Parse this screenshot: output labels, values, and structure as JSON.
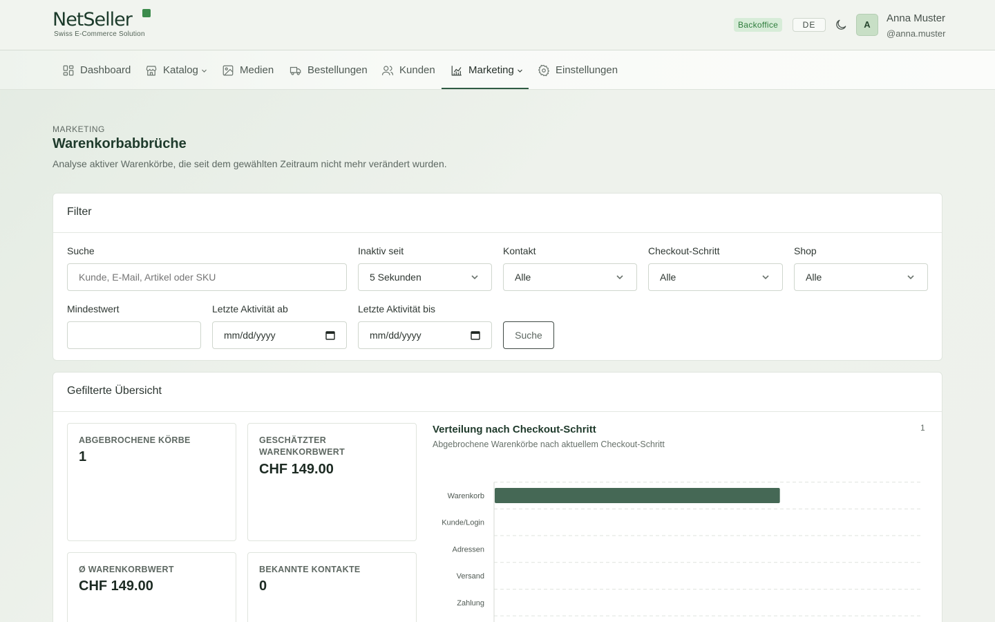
{
  "app": {
    "logo_text": "NetSeller",
    "logo_subtitle": "Swiss E-Commerce Solution",
    "backoffice_badge": "Backoffice",
    "language": "DE",
    "theme_icon": "moon-icon",
    "user": {
      "initial": "A",
      "name": "Anna Muster",
      "handle": "@anna.muster"
    }
  },
  "nav": {
    "items": [
      {
        "label": "Dashboard",
        "icon": "dashboard-icon"
      },
      {
        "label": "Katalog",
        "icon": "store-icon",
        "has_dropdown": true
      },
      {
        "label": "Medien",
        "icon": "image-icon"
      },
      {
        "label": "Bestellungen",
        "icon": "truck-icon"
      },
      {
        "label": "Kunden",
        "icon": "users-icon"
      },
      {
        "label": "Marketing",
        "icon": "chart-icon",
        "has_dropdown": true,
        "active": true
      },
      {
        "label": "Einstellungen",
        "icon": "gear-icon"
      }
    ]
  },
  "page": {
    "breadcrumb": "MARKETING",
    "title": "Warenkorbabbrüche",
    "description": "Analyse aktiver Warenkörbe, die seit dem gewählten Zeitraum nicht mehr verändert wurden."
  },
  "filter": {
    "title": "Filter",
    "search": {
      "label": "Suche",
      "placeholder": "Kunde, E-Mail, Artikel oder SKU",
      "value": ""
    },
    "inactive_since": {
      "label": "Inaktiv seit",
      "value": "5 Sekunden"
    },
    "contact": {
      "label": "Kontakt",
      "value": "Alle"
    },
    "checkout_step": {
      "label": "Checkout-Schritt",
      "value": "Alle"
    },
    "shop": {
      "label": "Shop",
      "value": "Alle"
    },
    "min_value": {
      "label": "Mindestwert",
      "value": ""
    },
    "last_activity_from": {
      "label": "Letzte Aktivität ab",
      "value": "mm/dd/yyyy"
    },
    "last_activity_to": {
      "label": "Letzte Aktivität bis",
      "value": "mm/dd/yyyy"
    },
    "search_button": "Suche"
  },
  "overview": {
    "title": "Gefilterte Übersicht",
    "stats": [
      {
        "label": "ABGEBROCHENE KÖRBE",
        "value": "1"
      },
      {
        "label": "GESCHÄTZTER WARENKORBWERT",
        "value": "CHF 149.00"
      },
      {
        "label": "Ø WARENKORBWERT",
        "value": "CHF 149.00"
      },
      {
        "label": "BEKANNTE KONTAKTE",
        "value": "0"
      }
    ]
  },
  "chart_data": {
    "type": "bar",
    "orientation": "horizontal",
    "title": "Verteilung nach Checkout-Schritt",
    "subtitle": "Abgebrochene Warenkörbe nach aktuellem Checkout-Schritt",
    "count_label": "1",
    "categories": [
      "Warenkorb",
      "Kunde/Login",
      "Adressen",
      "Versand",
      "Zahlung"
    ],
    "values": [
      1,
      0,
      0,
      0,
      0
    ],
    "xlim": [
      0,
      1.5
    ],
    "bar_color": "#456855",
    "grid": true
  }
}
